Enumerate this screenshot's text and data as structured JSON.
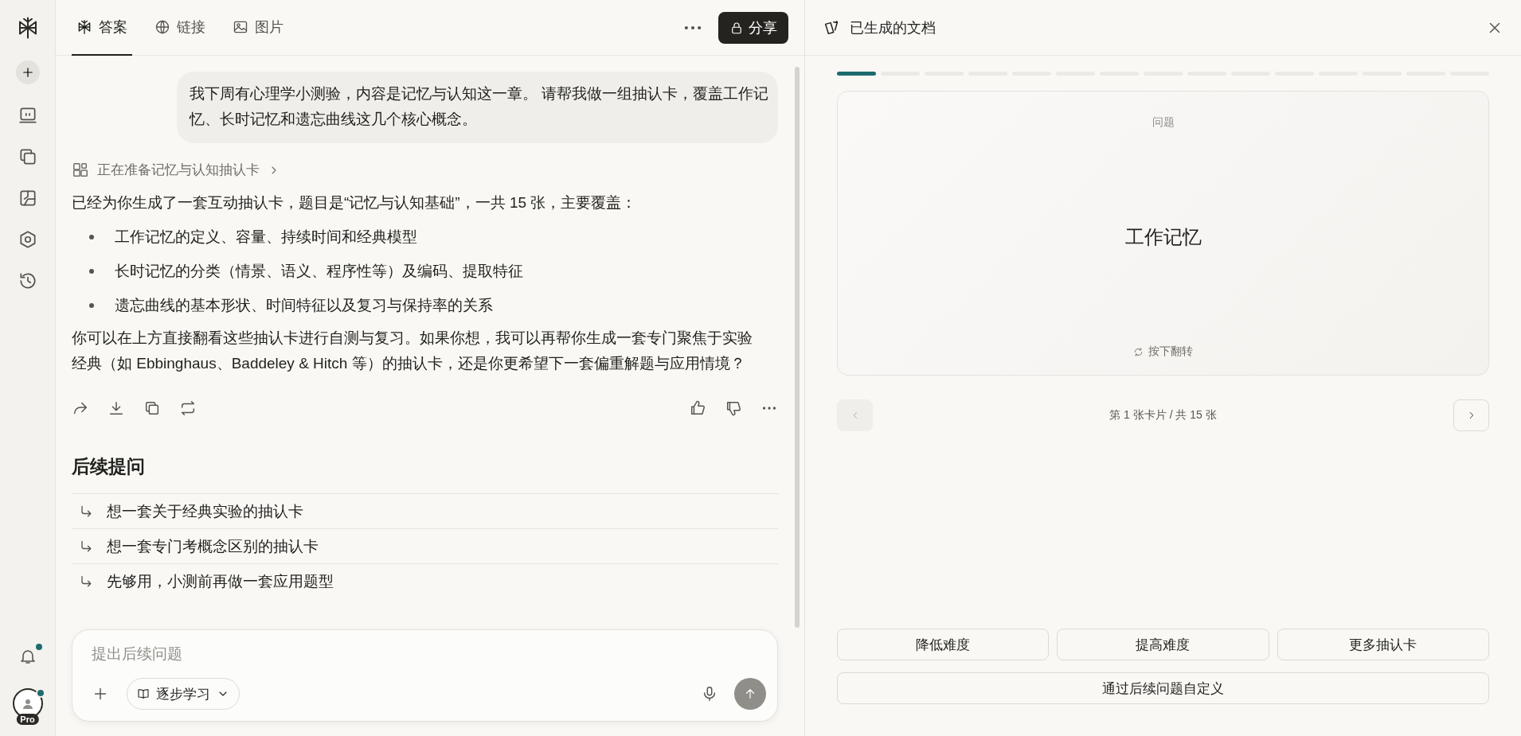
{
  "sidebar": {
    "notifications": {
      "unread": true
    },
    "account": {
      "badge": "Pro",
      "online": true
    }
  },
  "tabs": [
    {
      "kind": "answer",
      "label": "答案",
      "selected": true
    },
    {
      "kind": "links",
      "label": "链接",
      "selected": false
    },
    {
      "kind": "images",
      "label": "图片",
      "selected": false
    }
  ],
  "share_button": "分享",
  "user_message": "我下周有心理学小测验，内容是记忆与认知这一章。 请帮我做一组抽认卡，覆盖工作记忆、长时记忆和遗忘曲线这几个核心概念。",
  "status": "正在准备记忆与认知抽认卡",
  "answer": {
    "intro": "已经为你生成了一套互动抽认卡，题目是“记忆与认知基础”，一共 15 张，主要覆盖：",
    "bullets": [
      "工作记忆的定义、容量、持续时间和经典模型",
      "长时记忆的分类（情景、语义、程序性等）及编码、提取特征",
      "遗忘曲线的基本形状、时间特征以及复习与保持率的关系"
    ],
    "closing": "你可以在上方直接翻看这些抽认卡进行自测与复习。如果你想，我可以再帮你生成一套专门聚焦于实验经典（如 Ebbinghaus、Baddeley & Hitch 等）的抽认卡，还是你更希望下一套偏重解题与应用情境？"
  },
  "follow_ups": {
    "title": "后续提问",
    "items": [
      "想一套关于经典实验的抽认卡",
      "想一套专门考概念区别的抽认卡",
      "先够用，小测前再做一套应用题型"
    ]
  },
  "composer": {
    "placeholder": "提出后续问题",
    "mode": "逐步学习"
  },
  "panel": {
    "title": "已生成的文档",
    "progress": [
      {
        "selected": true
      },
      {
        "selected": false
      },
      {
        "selected": false
      },
      {
        "selected": false
      },
      {
        "selected": false
      },
      {
        "selected": false
      },
      {
        "selected": false
      },
      {
        "selected": false
      },
      {
        "selected": false
      },
      {
        "selected": false
      },
      {
        "selected": false
      },
      {
        "selected": false
      },
      {
        "selected": false
      },
      {
        "selected": false
      },
      {
        "selected": false
      }
    ],
    "card": {
      "label": "问题",
      "term": "工作记忆",
      "hint": "按下翻转"
    },
    "prev": {
      "disabled": true
    },
    "next": {
      "disabled": false
    },
    "pager": "第 1 张卡片 / 共 15 张",
    "actions": [
      "降低难度",
      "提高难度",
      "更多抽认卡"
    ],
    "custom": "通过后续问题自定义"
  }
}
